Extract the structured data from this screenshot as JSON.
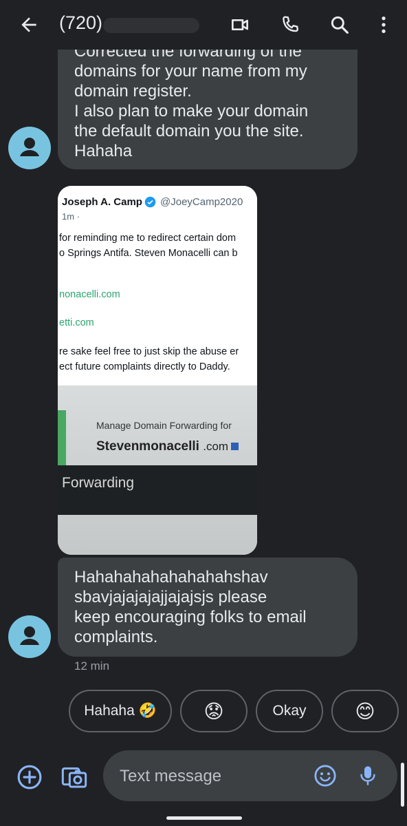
{
  "header": {
    "title": "(720)",
    "icons": [
      "back-arrow-icon",
      "video-call-icon",
      "phone-icon",
      "search-icon",
      "more-vert-icon"
    ]
  },
  "messages": {
    "first": {
      "lines": [
        "Corrected the forwarding of the",
        "domains for your name from my",
        "domain register.",
        "I also plan to make your domain",
        "the default domain you the site.",
        "Hahaha"
      ]
    },
    "image": {
      "tweet": {
        "name": "Joseph A. Camp",
        "handle": "@JoeyCamp2020",
        "time": "1m ·",
        "line1": "for reminding me to redirect certain dom",
        "line2": "o Springs Antifa. Steven Monacelli can b",
        "link1": "nonacelli.com",
        "link2": "etti.com",
        "line3": "re sake feel free to just skip the abuse er",
        "line4": "ect future complaints directly to Daddy."
      },
      "photo": {
        "heading": "Manage Domain Forwarding for",
        "domain": "Stevenmonacelli",
        "tld": ".com",
        "section": "Forwarding"
      }
    },
    "second": {
      "lines": [
        "Hahahahahahahahahshav",
        "sbavjajajajajjajajsjs please",
        "keep encouraging folks to email",
        "complaints."
      ],
      "timestamp": "12 min"
    }
  },
  "smart_replies": [
    {
      "label": "Hahaha 🤣"
    },
    {
      "label": "😟"
    },
    {
      "label": "Okay"
    },
    {
      "label": "😊"
    }
  ],
  "compose": {
    "placeholder": "Text message"
  },
  "colors": {
    "background": "#202124",
    "bubble": "#3c4043",
    "avatar": "#78c4e0",
    "accent": "#8ab4f8"
  }
}
